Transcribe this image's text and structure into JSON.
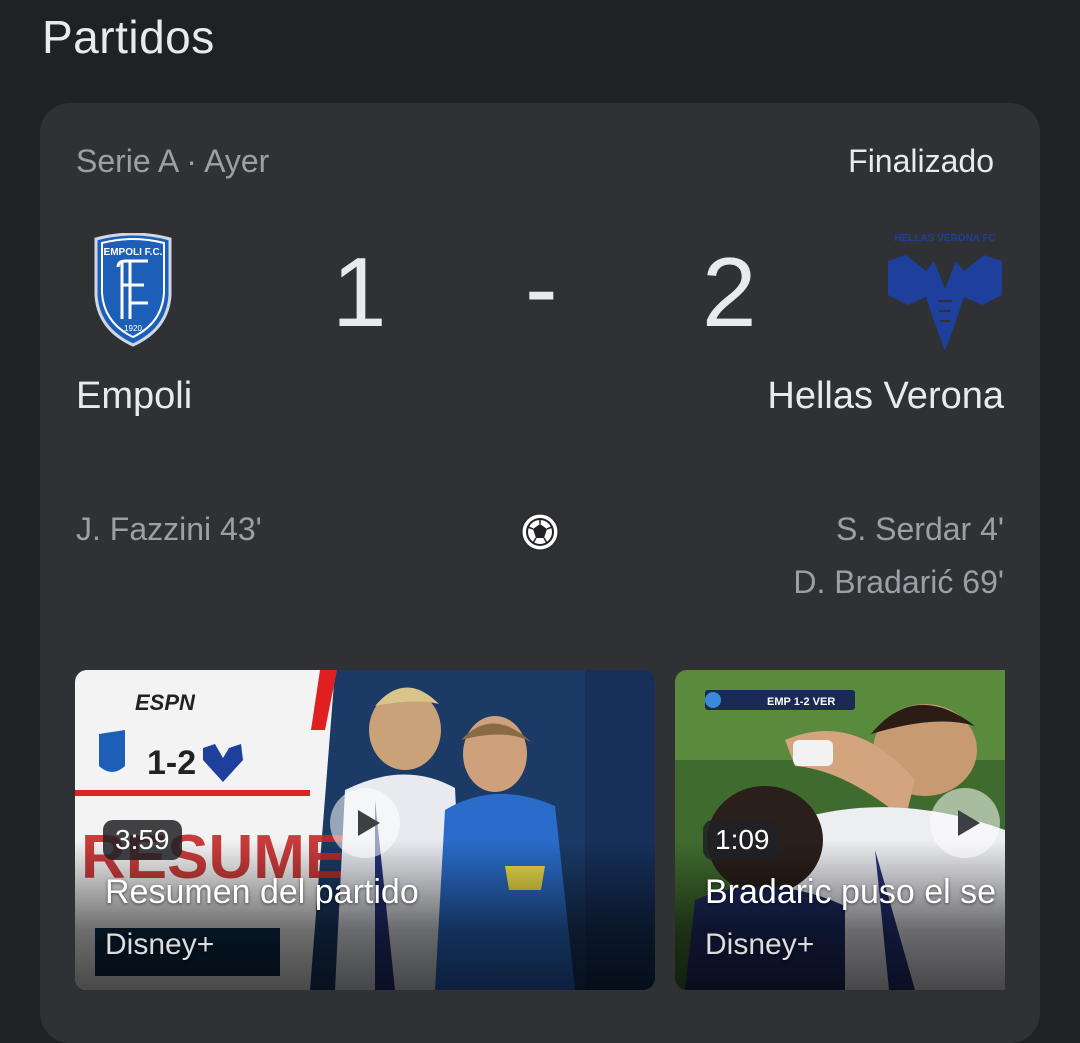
{
  "page": {
    "title": "Partidos"
  },
  "match": {
    "competition_date": "Serie A · Ayer",
    "status": "Finalizado",
    "home": {
      "name": "Empoli",
      "score": "1",
      "logo_text": "EMPOLI F.C.",
      "logo_year": "1920",
      "scorers": [
        "J. Fazzini 43'"
      ]
    },
    "away": {
      "name": "Hellas Verona",
      "score": "2",
      "logo_text": "HELLAS VERONA FC",
      "scorers": [
        "S. Serdar 4'",
        "D. Bradarić 69'"
      ]
    },
    "separator": "-",
    "goal_icon": "soccer-ball-icon"
  },
  "videos": [
    {
      "duration": "3:59",
      "title": "Resumen del partido",
      "source": "Disney+",
      "thumb_texts": {
        "brand": "ESPN",
        "score": "1-2",
        "overlay": "RESUMEN"
      },
      "icon": "play-icon"
    },
    {
      "duration": "1:09",
      "title": "Bradaric puso el se",
      "source": "Disney+",
      "thumb_texts": {
        "scorebug": "EMP 1-2 VER"
      },
      "icon": "play-icon"
    }
  ],
  "colors": {
    "background": "#202124",
    "card": "#303134",
    "primary_text": "#e8eaed",
    "secondary_text": "#9aa0a6",
    "empoli_blue": "#1d5fb8",
    "verona_blue": "#1e3f9c"
  }
}
